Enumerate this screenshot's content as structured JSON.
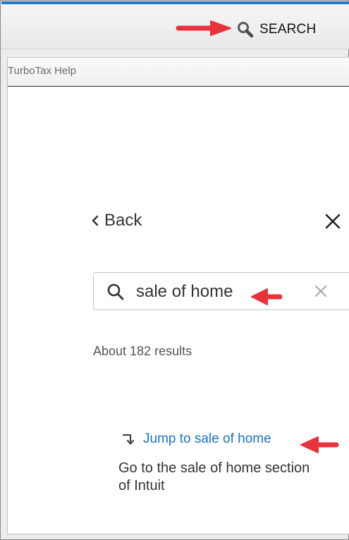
{
  "header": {
    "search_label": "SEARCH"
  },
  "panel": {
    "title": "TurboTax Help",
    "back_label": "Back"
  },
  "search": {
    "query": "sale of home"
  },
  "results": {
    "count_text": "About 182 results",
    "jump_link": "Jump to sale of home",
    "jump_description": "Go to the sale of home section of Intuit"
  },
  "colors": {
    "accent": "#1f78c8",
    "link": "#1a73c7",
    "annotation_arrow": "#e8333a"
  },
  "icons": [
    "search-icon",
    "chevron-left-icon",
    "close-icon",
    "clear-icon",
    "jump-arrow-icon",
    "annotation-arrow-icon"
  ]
}
